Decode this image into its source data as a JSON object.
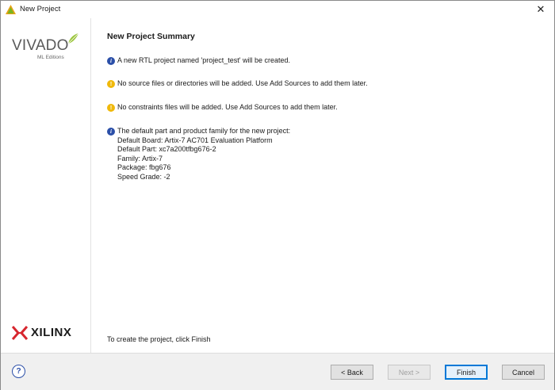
{
  "window": {
    "title": "New Project",
    "close_label": "✕"
  },
  "sidebar": {
    "vivado_text": "VIVADO",
    "edition_text": "ML Editions",
    "xilinx_text": "XILINX"
  },
  "main": {
    "title": "New Project Summary",
    "messages": [
      {
        "type": "info",
        "lines": [
          "A new RTL project named 'project_test' will be created."
        ]
      },
      {
        "type": "warning",
        "lines": [
          "No source files or directories will be added. Use Add Sources to add them later."
        ]
      },
      {
        "type": "warning",
        "lines": [
          "No constraints files will be added. Use Add Sources to add them later."
        ]
      },
      {
        "type": "info",
        "lines": [
          "The default part and product family for the new project:",
          "Default Board: Artix-7 AC701 Evaluation Platform",
          "Default Part: xc7a200tfbg676-2",
          "Family: Artix-7",
          "Package: fbg676",
          "Speed Grade: -2"
        ]
      }
    ],
    "finish_hint": "To create the project, click Finish"
  },
  "footer": {
    "help_label": "?",
    "back_label": "< Back",
    "next_label": "Next >",
    "finish_label": "Finish",
    "cancel_label": "Cancel"
  },
  "colors": {
    "info_icon": "#2b4fa8",
    "warning_icon": "#f0b90b",
    "finish_border": "#0078d7"
  }
}
